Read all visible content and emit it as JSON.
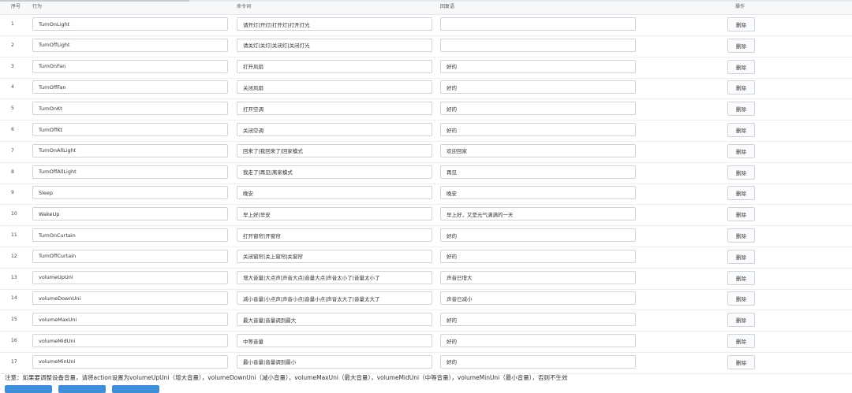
{
  "header": {
    "index": "序号",
    "action": "行为",
    "command": "命令词",
    "reply": "回复语",
    "operation": "操作"
  },
  "rows": [
    {
      "index": "1",
      "action": "TurnOnLight",
      "command": "请开灯|开灯|打开灯|打开灯光",
      "reply": "",
      "delete": "删除"
    },
    {
      "index": "2",
      "action": "TurnOffLight",
      "command": "请关灯|关灯|关闭灯|关闭灯光",
      "reply": "",
      "delete": "删除"
    },
    {
      "index": "3",
      "action": "TurnOnFan",
      "command": "打开风扇",
      "reply": "好的",
      "delete": "删除"
    },
    {
      "index": "4",
      "action": "TurnOffFan",
      "command": "关闭风扇",
      "reply": "好的",
      "delete": "删除"
    },
    {
      "index": "5",
      "action": "TurnOnKt",
      "command": "打开空调",
      "reply": "好的",
      "delete": "删除"
    },
    {
      "index": "6",
      "action": "TurnOffKt",
      "command": "关闭空调",
      "reply": "好的",
      "delete": "删除"
    },
    {
      "index": "7",
      "action": "TurnOnAllLight",
      "command": "回来了|我回来了|回家模式",
      "reply": "欢迎回家",
      "delete": "删除"
    },
    {
      "index": "8",
      "action": "TurnOffAllLight",
      "command": "我走了|再见|离家模式",
      "reply": "再见",
      "delete": "删除"
    },
    {
      "index": "9",
      "action": "Sleep",
      "command": "晚安",
      "reply": "晚安",
      "delete": "删除"
    },
    {
      "index": "10",
      "action": "WakeUp",
      "command": "早上好|早安",
      "reply": "早上好，又是元气满满的一天",
      "delete": "删除"
    },
    {
      "index": "11",
      "action": "TurnOnCurtain",
      "command": "打开窗帘|开窗帘",
      "reply": "好的",
      "delete": "删除"
    },
    {
      "index": "12",
      "action": "TurnOffCurtain",
      "command": "关闭窗帘|关上窗帘|关窗帘",
      "reply": "好的",
      "delete": "删除"
    },
    {
      "index": "13",
      "action": "volumeUpUni",
      "command": "增大音量|大点声|声音大点|音量大点|声音太小了|音量太小了",
      "reply": "声音已增大",
      "delete": "删除"
    },
    {
      "index": "14",
      "action": "volumeDownUni",
      "command": "减小音量|小点声|声音小点|音量小点|声音太大了|音量太大了",
      "reply": "声音已减小",
      "delete": "删除"
    },
    {
      "index": "15",
      "action": "volumeMaxUni",
      "command": "最大音量|音量调到最大",
      "reply": "好的",
      "delete": "删除"
    },
    {
      "index": "16",
      "action": "volumeMidUni",
      "command": "中等音量",
      "reply": "好的",
      "delete": "删除"
    },
    {
      "index": "17",
      "action": "volumeMinUni",
      "command": "最小音量|音量调到最小",
      "reply": "好的",
      "delete": "删除"
    }
  ],
  "note": "注意：如果要调整设备音量，请将action设置为volumeUpUni（增大音量），volumeDownUni（减小音量），volumeMaxUni（最大音量），volumeMidUni（中等音量），volumeMinUni（最小音量），否则不生效"
}
